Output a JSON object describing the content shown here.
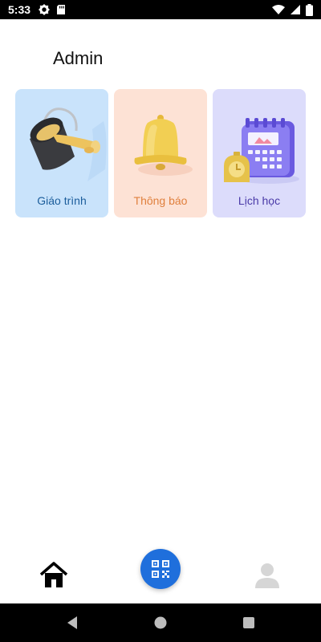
{
  "status_bar": {
    "time": "5:33",
    "icons": [
      "settings-icon",
      "sd-card-icon",
      "wifi-icon",
      "cellular-icon",
      "battery-icon"
    ]
  },
  "header": {
    "title": "Admin"
  },
  "cards": [
    {
      "label": "Giáo trình",
      "icon": "paint-bucket-icon",
      "bg": "#c9e3fb",
      "color": "#1b5d9b"
    },
    {
      "label": "Thông báo",
      "icon": "bell-icon",
      "bg": "#fde2d5",
      "color": "#e0803e"
    },
    {
      "label": "Lịch học",
      "icon": "calendar-clock-icon",
      "bg": "#dcdcfb",
      "color": "#4a3aa8"
    }
  ],
  "bottom_nav": {
    "items": [
      "home-icon",
      "qr-code-icon",
      "profile-icon"
    ],
    "accent": "#1f6fdc"
  },
  "system_nav": [
    "back-icon",
    "home-circle-icon",
    "recents-icon"
  ]
}
